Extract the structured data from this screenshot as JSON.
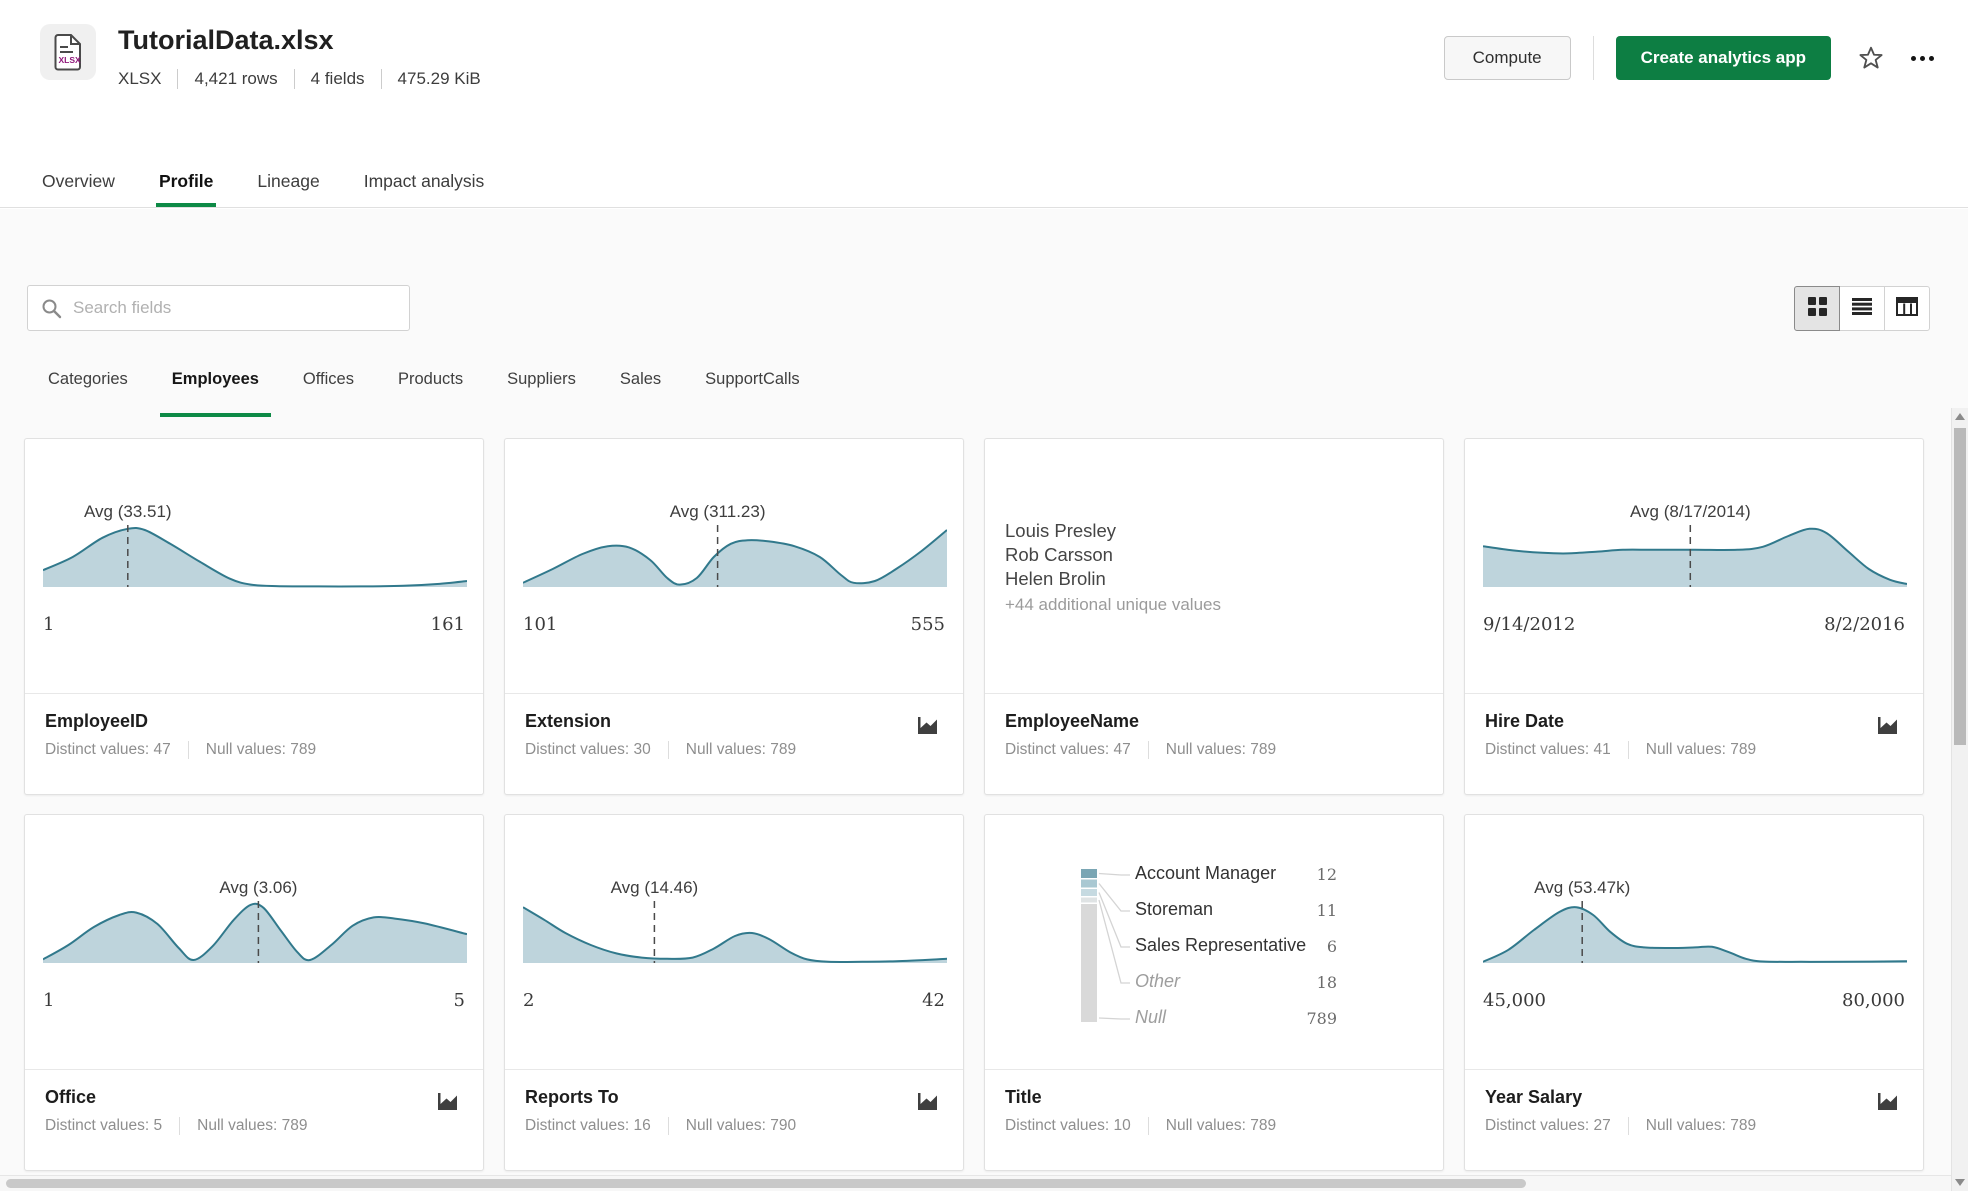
{
  "colors": {
    "green_button": "#0d7e43",
    "green_underline": "#0d8a46",
    "chart_stroke": "#31798c",
    "chart_fill": "#bed4dc",
    "dash_line": "#4a4a4a"
  },
  "header": {
    "title": "TutorialData.xlsx",
    "file_icon_label": "XLSX",
    "meta": [
      "XLSX",
      "4,421 rows",
      "4 fields",
      "475.29 KiB"
    ],
    "compute_label": "Compute",
    "create_app_label": "Create analytics app"
  },
  "nav_tabs": [
    {
      "label": "Overview",
      "active": false
    },
    {
      "label": "Profile",
      "active": true
    },
    {
      "label": "Lineage",
      "active": false
    },
    {
      "label": "Impact analysis",
      "active": false
    }
  ],
  "toolbar": {
    "search_placeholder": "Search fields",
    "view_toggles": [
      "grid",
      "list",
      "table"
    ],
    "active_toggle": "grid"
  },
  "field_tabs": [
    {
      "label": "Categories",
      "active": false
    },
    {
      "label": "Employees",
      "active": true
    },
    {
      "label": "Offices",
      "active": false
    },
    {
      "label": "Products",
      "active": false
    },
    {
      "label": "Suppliers",
      "active": false
    },
    {
      "label": "Sales",
      "active": false
    },
    {
      "label": "SupportCalls",
      "active": false
    }
  ],
  "footer_labels": {
    "distinct": "Distinct values:",
    "nulls": "Null values:"
  },
  "cards": [
    {
      "name": "EmployeeID",
      "distinct_value": "47",
      "null_value": "789",
      "icon": false,
      "chart": {
        "type": "density",
        "avg_label": "Avg (33.51)",
        "avg_x": 0.2,
        "min": "1",
        "max": "161",
        "curve": [
          [
            0,
            0.28
          ],
          [
            0.07,
            0.5
          ],
          [
            0.14,
            0.82
          ],
          [
            0.2,
            0.97
          ],
          [
            0.24,
            0.95
          ],
          [
            0.3,
            0.72
          ],
          [
            0.37,
            0.42
          ],
          [
            0.44,
            0.14
          ],
          [
            0.49,
            0.04
          ],
          [
            0.55,
            0.015
          ],
          [
            0.65,
            0.01
          ],
          [
            0.75,
            0.01
          ],
          [
            0.85,
            0.02
          ],
          [
            0.93,
            0.05
          ],
          [
            1,
            0.1
          ]
        ]
      }
    },
    {
      "name": "Extension",
      "distinct_value": "30",
      "null_value": "789",
      "icon": true,
      "chart": {
        "type": "density",
        "avg_label": "Avg (311.23)",
        "avg_x": 0.459,
        "min": "101",
        "max": "555",
        "curve": [
          [
            0,
            0.07
          ],
          [
            0.07,
            0.3
          ],
          [
            0.14,
            0.55
          ],
          [
            0.2,
            0.68
          ],
          [
            0.25,
            0.66
          ],
          [
            0.3,
            0.45
          ],
          [
            0.34,
            0.15
          ],
          [
            0.37,
            0.04
          ],
          [
            0.41,
            0.15
          ],
          [
            0.45,
            0.5
          ],
          [
            0.49,
            0.72
          ],
          [
            0.53,
            0.78
          ],
          [
            0.58,
            0.76
          ],
          [
            0.64,
            0.68
          ],
          [
            0.7,
            0.5
          ],
          [
            0.75,
            0.2
          ],
          [
            0.78,
            0.07
          ],
          [
            0.83,
            0.1
          ],
          [
            0.88,
            0.3
          ],
          [
            0.94,
            0.6
          ],
          [
            1,
            0.95
          ]
        ]
      }
    },
    {
      "name": "EmployeeName",
      "distinct_value": "47",
      "null_value": "789",
      "icon": false,
      "chart": {
        "type": "samples",
        "values": [
          "Louis Presley",
          "Rob Carsson",
          "Helen Brolin"
        ],
        "more": "+44 additional unique values"
      }
    },
    {
      "name": "Hire Date",
      "distinct_value": "41",
      "null_value": "789",
      "icon": true,
      "chart": {
        "type": "density",
        "avg_label": "Avg (8/17/2014)",
        "avg_x": 0.489,
        "min": "9/14/2012",
        "max": "8/2/2016",
        "curve": [
          [
            0,
            0.68
          ],
          [
            0.07,
            0.61
          ],
          [
            0.14,
            0.57
          ],
          [
            0.2,
            0.56
          ],
          [
            0.27,
            0.59
          ],
          [
            0.33,
            0.62
          ],
          [
            0.4,
            0.62
          ],
          [
            0.5,
            0.62
          ],
          [
            0.6,
            0.62
          ],
          [
            0.66,
            0.67
          ],
          [
            0.72,
            0.85
          ],
          [
            0.77,
            0.97
          ],
          [
            0.81,
            0.9
          ],
          [
            0.86,
            0.6
          ],
          [
            0.91,
            0.3
          ],
          [
            0.96,
            0.12
          ],
          [
            1,
            0.05
          ]
        ]
      }
    },
    {
      "name": "Office",
      "distinct_value": "5",
      "null_value": "789",
      "icon": true,
      "chart": {
        "type": "density",
        "avg_label": "Avg (3.06)",
        "avg_x": 0.508,
        "min": "1",
        "max": "5",
        "curve": [
          [
            0,
            0.06
          ],
          [
            0.06,
            0.3
          ],
          [
            0.12,
            0.6
          ],
          [
            0.18,
            0.8
          ],
          [
            0.22,
            0.84
          ],
          [
            0.27,
            0.65
          ],
          [
            0.32,
            0.25
          ],
          [
            0.355,
            0.05
          ],
          [
            0.4,
            0.28
          ],
          [
            0.45,
            0.72
          ],
          [
            0.49,
            0.97
          ],
          [
            0.52,
            0.92
          ],
          [
            0.56,
            0.55
          ],
          [
            0.6,
            0.18
          ],
          [
            0.63,
            0.05
          ],
          [
            0.68,
            0.3
          ],
          [
            0.73,
            0.62
          ],
          [
            0.78,
            0.76
          ],
          [
            0.83,
            0.74
          ],
          [
            0.9,
            0.66
          ],
          [
            1,
            0.48
          ]
        ]
      }
    },
    {
      "name": "Reports To",
      "distinct_value": "16",
      "null_value": "790",
      "icon": true,
      "chart": {
        "type": "density",
        "avg_label": "Avg (14.46)",
        "avg_x": 0.31,
        "min": "2",
        "max": "42",
        "curve": [
          [
            0,
            0.93
          ],
          [
            0.05,
            0.72
          ],
          [
            0.1,
            0.5
          ],
          [
            0.16,
            0.3
          ],
          [
            0.22,
            0.16
          ],
          [
            0.28,
            0.09
          ],
          [
            0.34,
            0.07
          ],
          [
            0.4,
            0.09
          ],
          [
            0.45,
            0.24
          ],
          [
            0.5,
            0.45
          ],
          [
            0.54,
            0.5
          ],
          [
            0.58,
            0.4
          ],
          [
            0.63,
            0.18
          ],
          [
            0.67,
            0.06
          ],
          [
            0.72,
            0.02
          ],
          [
            0.8,
            0.02
          ],
          [
            0.88,
            0.03
          ],
          [
            1,
            0.07
          ]
        ]
      }
    },
    {
      "name": "Title",
      "distinct_value": "10",
      "null_value": "789",
      "icon": false,
      "chart": {
        "type": "topvalues",
        "items": [
          {
            "label": "Account Manager",
            "value": "12",
            "muted": false,
            "color": "#7aa6b4",
            "h": 9
          },
          {
            "label": "Storeman",
            "value": "11",
            "muted": false,
            "color": "#a9c8d2",
            "h": 8
          },
          {
            "label": "Sales Representative",
            "value": "6",
            "muted": false,
            "color": "#c6dae1",
            "h": 7
          },
          {
            "label": "Other",
            "value": "18",
            "muted": true,
            "color": "#dfe3e4",
            "h": 5
          },
          {
            "label": "Null",
            "value": "789",
            "muted": true,
            "color": "#d9d9d9",
            "h": 118
          }
        ]
      }
    },
    {
      "name": "Year Salary",
      "distinct_value": "27",
      "null_value": "789",
      "icon": true,
      "chart": {
        "type": "density",
        "avg_label": "Avg (53.47k)",
        "avg_x": 0.234,
        "min": "45,000",
        "max": "80,000",
        "curve": [
          [
            0,
            0.02
          ],
          [
            0.06,
            0.22
          ],
          [
            0.12,
            0.55
          ],
          [
            0.18,
            0.85
          ],
          [
            0.22,
            0.93
          ],
          [
            0.26,
            0.8
          ],
          [
            0.3,
            0.52
          ],
          [
            0.34,
            0.32
          ],
          [
            0.38,
            0.26
          ],
          [
            0.44,
            0.25
          ],
          [
            0.5,
            0.26
          ],
          [
            0.54,
            0.27
          ],
          [
            0.58,
            0.18
          ],
          [
            0.62,
            0.07
          ],
          [
            0.66,
            0.025
          ],
          [
            0.75,
            0.02
          ],
          [
            0.85,
            0.02
          ],
          [
            1,
            0.03
          ]
        ]
      }
    }
  ]
}
